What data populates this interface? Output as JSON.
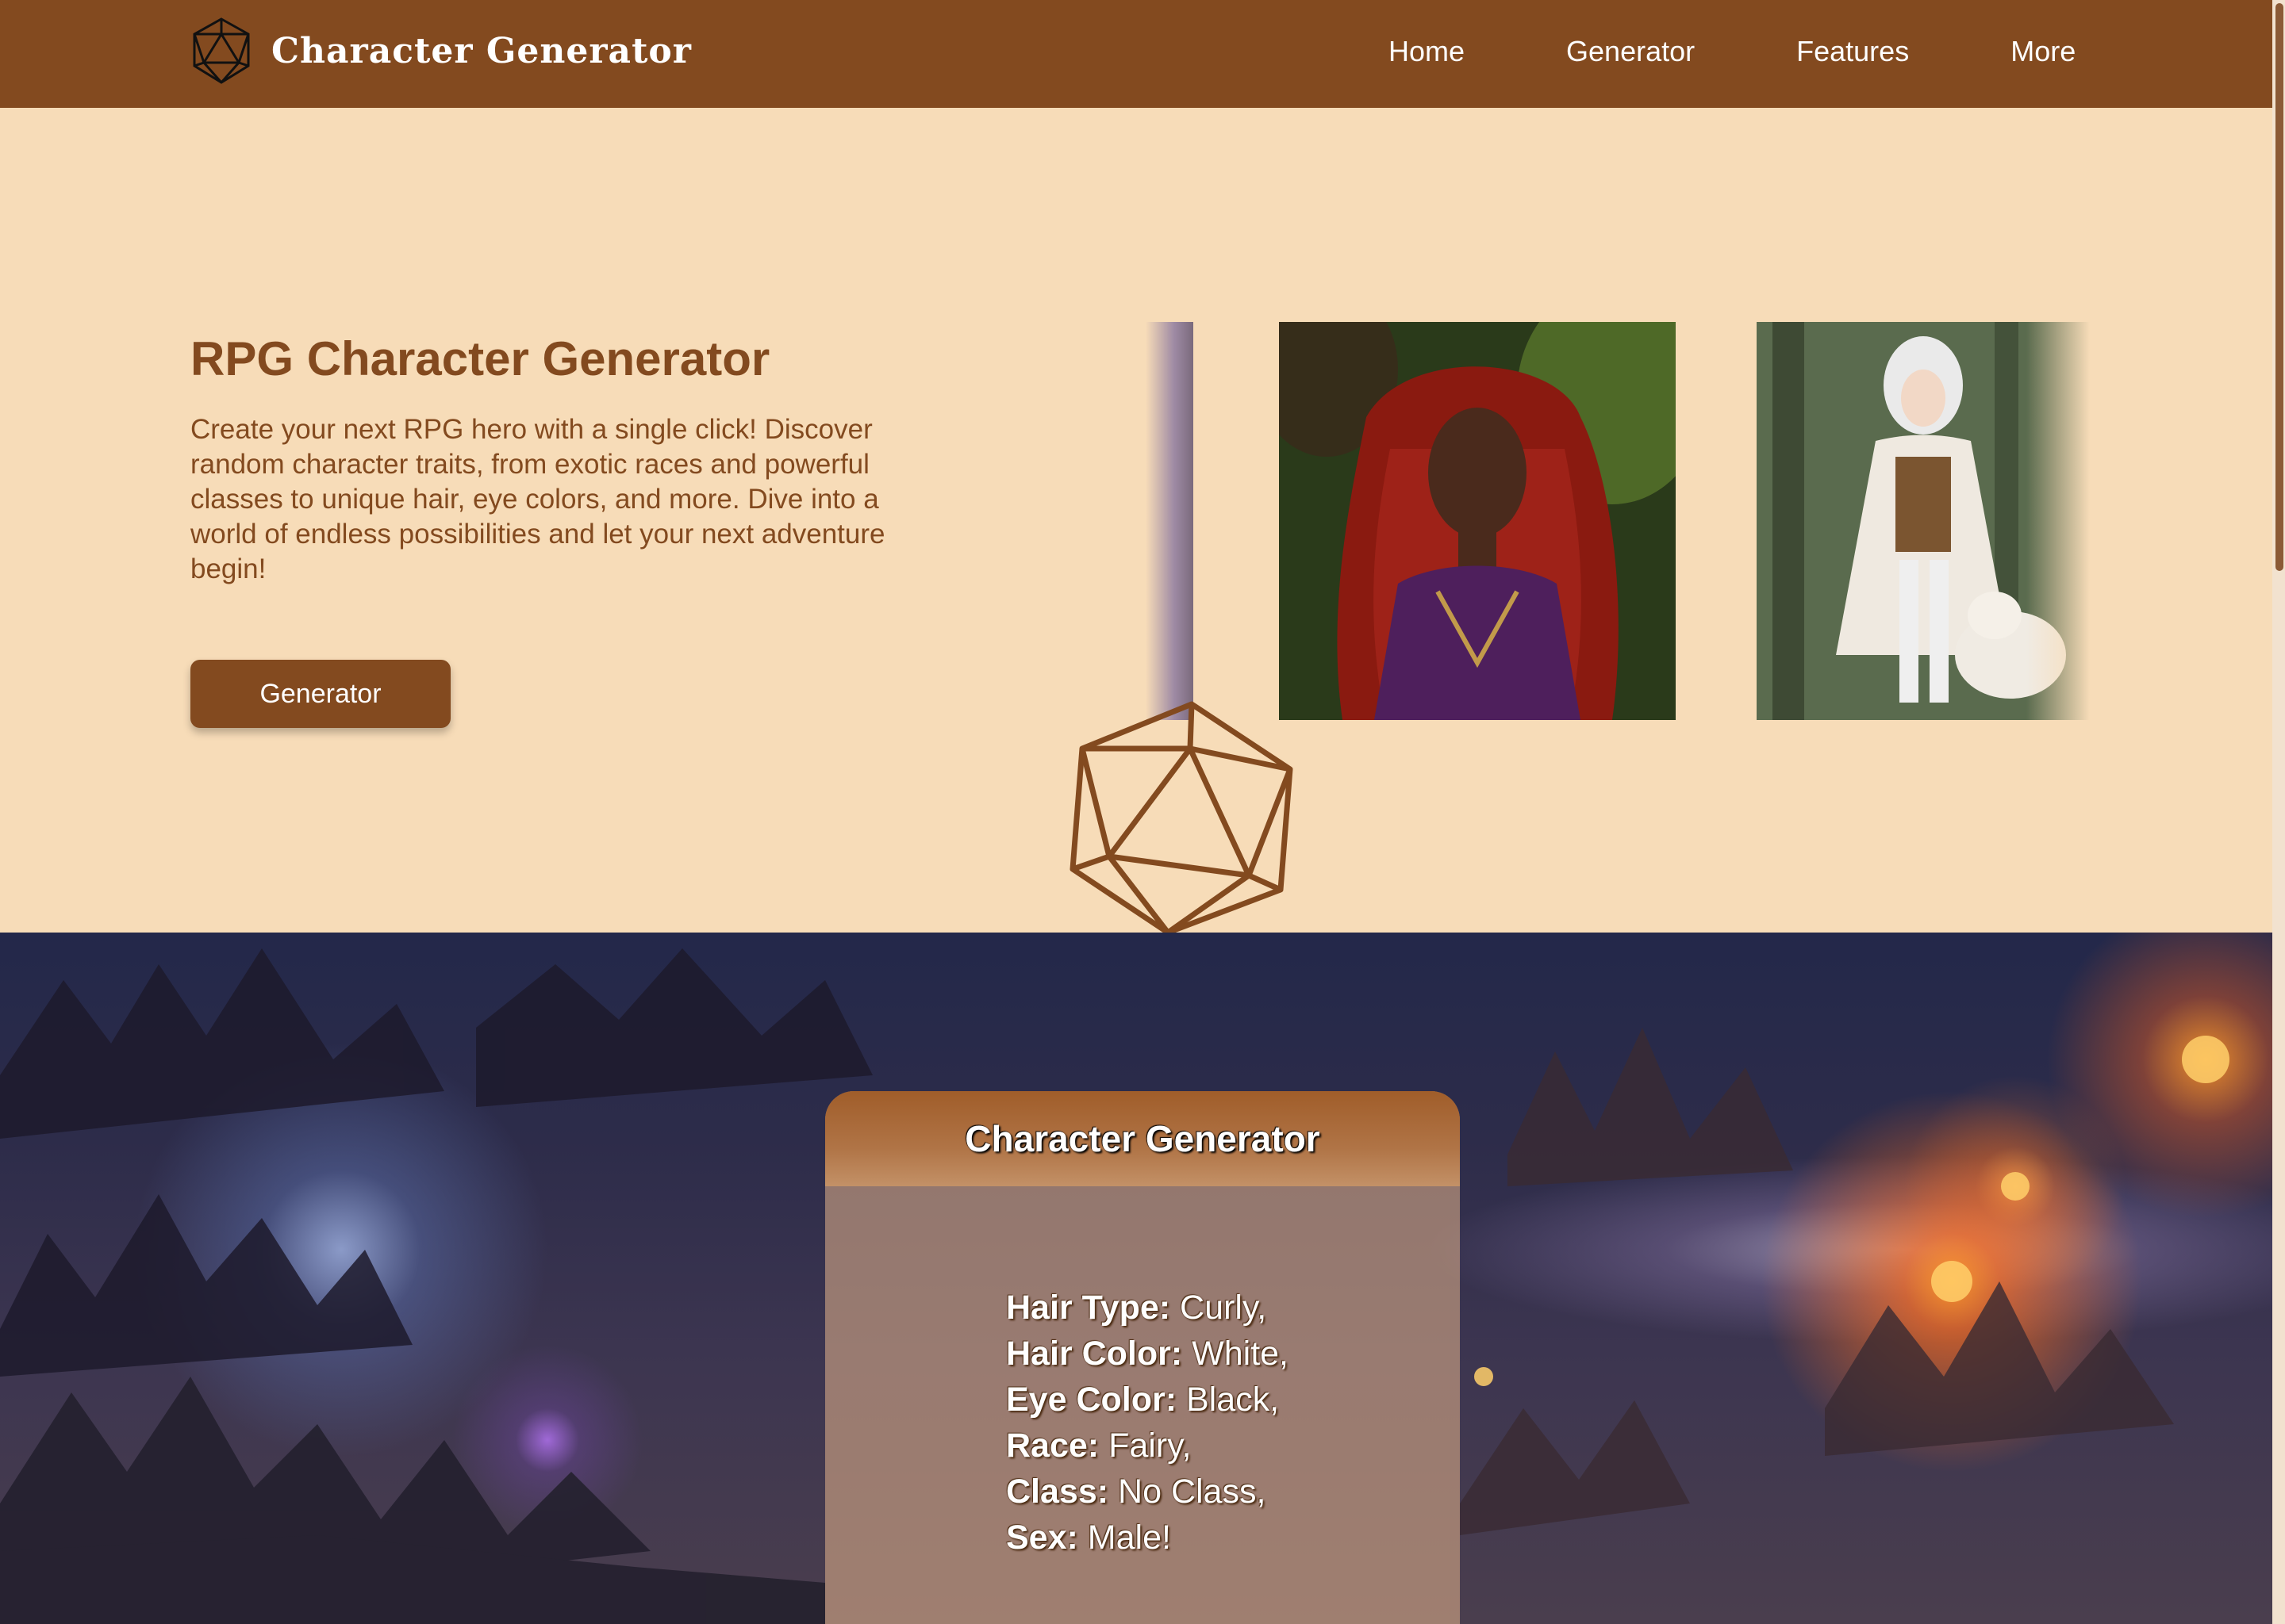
{
  "nav": {
    "brand": "Character Generator",
    "links": [
      "Home",
      "Generator",
      "Features",
      "More"
    ]
  },
  "hero": {
    "title": "RPG Character Generator",
    "description": "Create your next RPG hero with a single click! Discover random character traits, from exotic races and powerful classes to unique hair, eye colors, and more. Dive into a world of endless possibilities and let your next adventure begin!",
    "button_label": "Generator"
  },
  "carousel": {
    "images": [
      "partial-character-image",
      "red-haired-sorceress-image",
      "white-haired-elf-with-wolf-image"
    ]
  },
  "generator_card": {
    "title": "Character Generator",
    "traits": [
      {
        "label": "Hair Type:",
        "value": "Curly,"
      },
      {
        "label": "Hair Color:",
        "value": "White,"
      },
      {
        "label": "Eye Color:",
        "value": "Black,"
      },
      {
        "label": "Race:",
        "value": "Fairy,"
      },
      {
        "label": "Class:",
        "value": "No Class,"
      },
      {
        "label": "Sex:",
        "value": "Male!"
      }
    ]
  },
  "colors": {
    "brand_brown": "#834a1f",
    "page_bg": "#f7dcb8",
    "white": "#ffffff"
  }
}
